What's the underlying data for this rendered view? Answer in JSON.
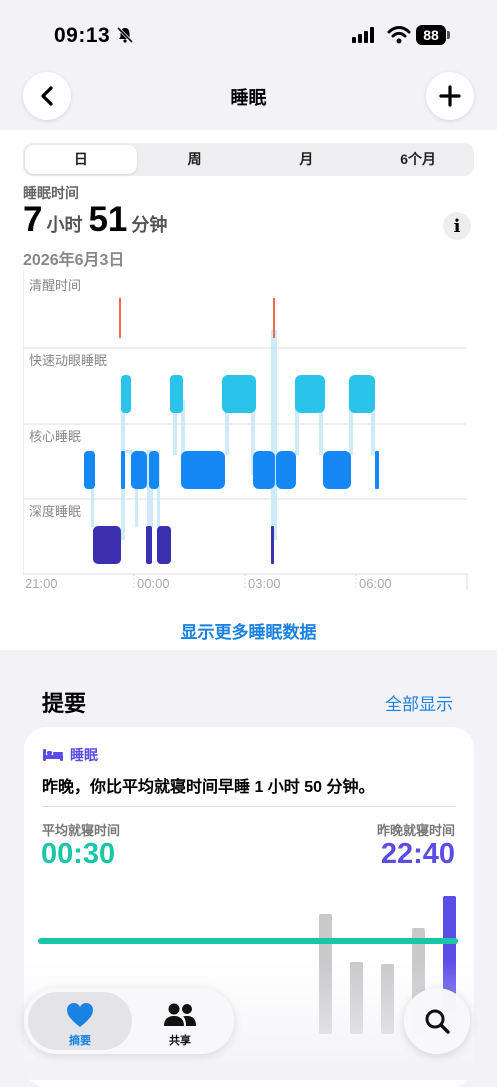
{
  "status": {
    "time": "09:13",
    "battery": "88"
  },
  "nav": {
    "title": "睡眠"
  },
  "segments": [
    "日",
    "周",
    "月",
    "6个月"
  ],
  "sleep": {
    "label": "睡眠时间",
    "hours": "7",
    "hours_unit": "小时",
    "minutes": "51",
    "minutes_unit": "分钟",
    "date": "2026年6月3日"
  },
  "chart_data": {
    "type": "timeline",
    "stages": [
      "清醒时间",
      "快速动眼睡眠",
      "核心睡眠",
      "深度睡眠"
    ],
    "x_ticks": [
      "21:00",
      "00:00",
      "03:00",
      "06:00"
    ]
  },
  "more_link": "显示更多睡眠数据",
  "summary": {
    "title": "提要",
    "show_all": "全部显示",
    "tag": "睡眠",
    "text": "昨晚，你比平均就寝时间早睡 1 小时 50 分钟。",
    "avg_label": "平均就寝时间",
    "avg_value": "00:30",
    "last_label": "昨晚就寝时间",
    "last_value": "22:40"
  },
  "tabs": [
    {
      "label": "摘要"
    },
    {
      "label": "共享"
    }
  ],
  "colors": {
    "accent": "#1a82e2",
    "avg": "#17c7a6",
    "last": "#5a4de6",
    "awake": "#f06a4e",
    "rem": "#2ac3ea",
    "core": "#1588f5",
    "deep": "#3a30b0"
  }
}
